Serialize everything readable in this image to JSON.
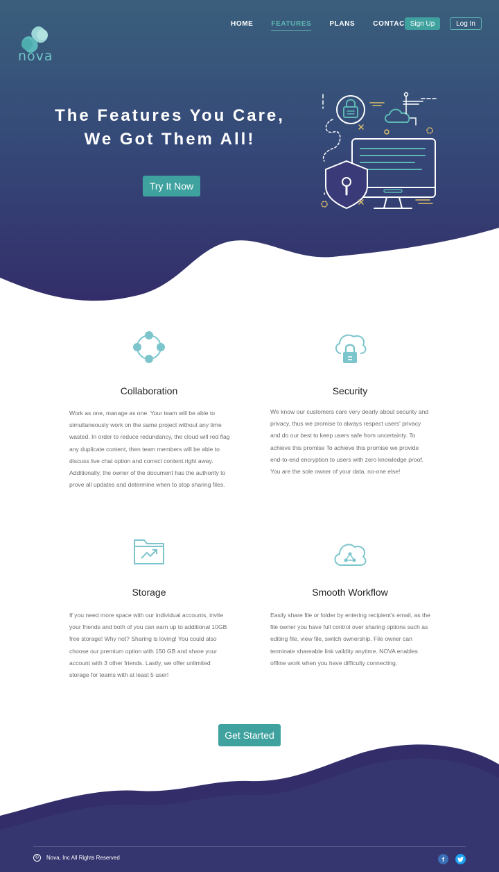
{
  "brand": {
    "name": "nova"
  },
  "nav": {
    "items": [
      {
        "label": "HOME",
        "active": false
      },
      {
        "label": "FEATURES",
        "active": true
      },
      {
        "label": "PLANS",
        "active": false
      },
      {
        "label": "CONTACT",
        "active": false
      }
    ],
    "signup_label": "Sign Up",
    "login_label": "Log In"
  },
  "hero": {
    "title_line1": "The Features You Care,",
    "title_line2": "We Got Them All!",
    "cta_label": "Try It Now"
  },
  "features": [
    {
      "icon": "collaboration-icon",
      "title": "Collaboration",
      "body": "Work as one, manage as one. Your team will be able to simultaneously work on the same project without any time wasted. In order to reduce redundancy, the cloud will red flag any duplicate content, then team members will be able to discuss live chat option and correct content right away. Additionally, the owner of the document has the authority to prove all updates and determine when to stop sharing files."
    },
    {
      "icon": "cloud-lock-icon",
      "title": "Security",
      "body": "We know our customers care very dearly about security and privacy, thus we promise to always respect users' privacy and do our best to keep users safe from uncertainty. To achieve this promise To achieve this promise we provide end-to-end encryption to users with zero knowledge proof. You are the sole owner of your data, no-one else!"
    },
    {
      "icon": "folder-chart-icon",
      "title": "Storage",
      "body": "If you need more space with our individual accounts, invite your friends and both of you can earn up to additional 10GB free storage! Why not? Sharing is loving! You could also choose our premium option with 150 GB and share your account with 3 other friends. Lastly, we offer unlimited storage for teams with at least 5 user!"
    },
    {
      "icon": "cloud-share-icon",
      "title": "Smooth Workflow",
      "body": "Easily share file or folder by entering recipient's email, as the file owner you have full control over sharing options such as editing file, view file, switch ownership. File owner can terminate shareable link vaildity anytime. NOVA enables offline work when you have difficulty connecting."
    }
  ],
  "cta": {
    "label": "Get Started"
  },
  "footer": {
    "copyright": "Nova, Inc  All Rights Reserved",
    "social": [
      "facebook-icon",
      "twitter-icon"
    ]
  },
  "colors": {
    "hero_top": "#3a5f7c",
    "hero_bottom": "#332d6a",
    "accent": "#3fa29f",
    "icon_teal": "#7cc5cc",
    "footer": "#352f6a"
  }
}
